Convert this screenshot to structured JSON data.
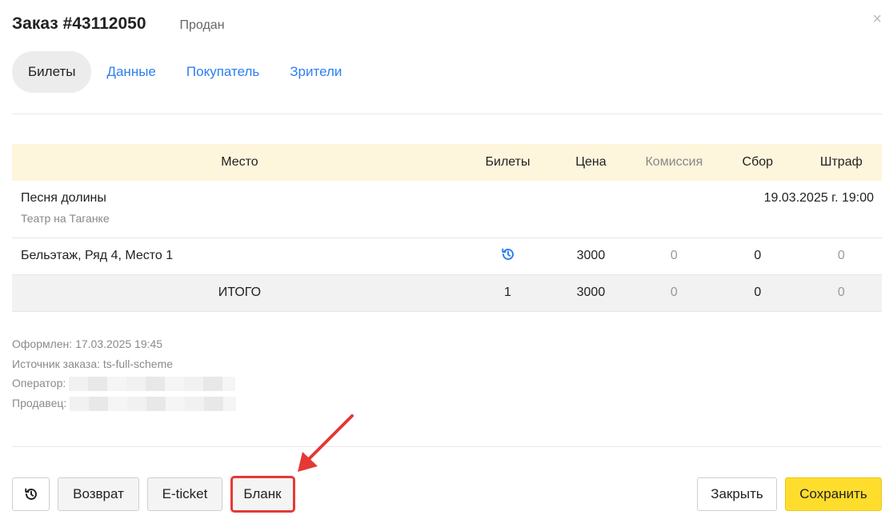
{
  "header": {
    "title": "Заказ #43112050",
    "status": "Продан",
    "close_glyph": "×"
  },
  "tabs": [
    {
      "label": "Билеты",
      "active": true
    },
    {
      "label": "Данные",
      "active": false
    },
    {
      "label": "Покупатель",
      "active": false
    },
    {
      "label": "Зрители",
      "active": false
    }
  ],
  "table": {
    "columns": [
      "Место",
      "Билеты",
      "Цена",
      "Комиссия",
      "Сбор",
      "Штраф"
    ],
    "event": {
      "title": "Песня долины",
      "venue": "Театр на Таганке",
      "datetime": "19.03.2025 г. 19:00"
    },
    "seat_row": {
      "place": "Бельэтаж, Ряд 4, Место 1",
      "tickets_icon": "history-icon",
      "price": "3000",
      "commission": "0",
      "fee": "0",
      "fine": "0"
    },
    "total_row": {
      "label": "ИТОГО",
      "tickets": "1",
      "price": "3000",
      "commission": "0",
      "fee": "0",
      "fine": "0"
    }
  },
  "info": {
    "created": "Оформлен: 17.03.2025 19:45",
    "source": "Источник заказа: ts-full-scheme",
    "operator_label": "Оператор:",
    "seller_label": "Продавец:"
  },
  "footer": {
    "history_icon": "history-icon",
    "return_label": "Возврат",
    "eticket_label": "E-ticket",
    "blank_label": "Бланк",
    "close_label": "Закрыть",
    "save_label": "Сохранить"
  },
  "colors": {
    "accent": "#2d7ff0",
    "save": "#ffdd2d",
    "header_row": "#fdf5dc",
    "annotation": "#e53935"
  }
}
